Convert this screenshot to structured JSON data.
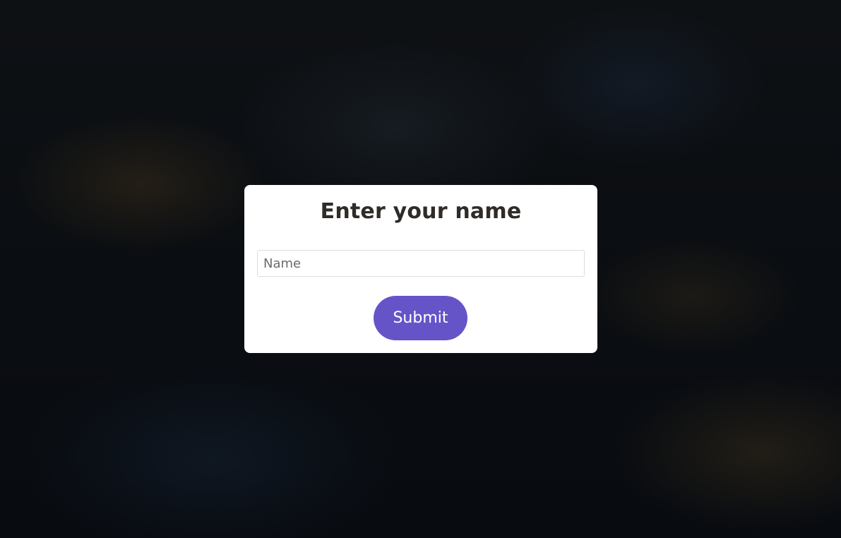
{
  "dialog": {
    "title": "Enter your name",
    "name_input": {
      "value": "",
      "placeholder": "Name"
    },
    "submit_label": "Submit"
  },
  "colors": {
    "accent": "#6554c8",
    "title_text": "#2e2b28",
    "backdrop": "#0b0e12"
  }
}
